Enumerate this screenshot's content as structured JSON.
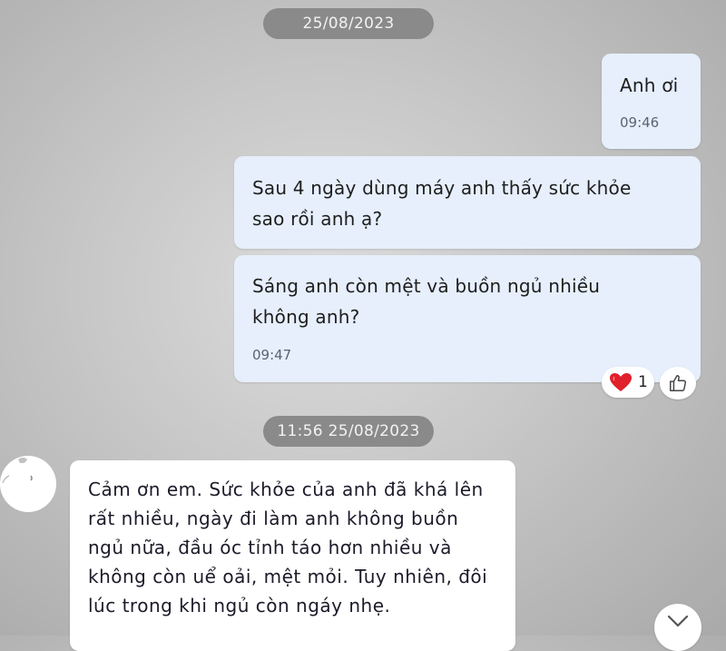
{
  "dates": {
    "first": "25/08/2023",
    "second": "11:56 25/08/2023"
  },
  "messages": [
    {
      "text": "Anh ơi",
      "time": "09:46"
    },
    {
      "text_lines": [
        "Sau 4 ngày dùng máy anh thấy sức khỏe",
        "sao rồi anh ạ?"
      ]
    },
    {
      "text_lines": [
        "Sáng anh còn mệt và buồn ngủ nhiều",
        "không anh?"
      ],
      "time": "09:47"
    },
    {
      "text_lines": [
        "Cảm ơn em. Sức khỏe của anh đã khá lên",
        "rất nhiều, ngày đi làm anh không buồn",
        "ngủ nữa, đầu óc tỉnh táo hơn nhiều và",
        "không còn uể oải, mệt mỏi. Tuy nhiên, đôi",
        "lúc trong khi ngủ còn ngáy nhẹ."
      ]
    }
  ],
  "reaction": {
    "icon": "heart-icon",
    "count": "1",
    "color": "#e0202a"
  },
  "icons": {
    "like": "thumbs-up-icon",
    "scroll": "chevron-down-icon"
  }
}
